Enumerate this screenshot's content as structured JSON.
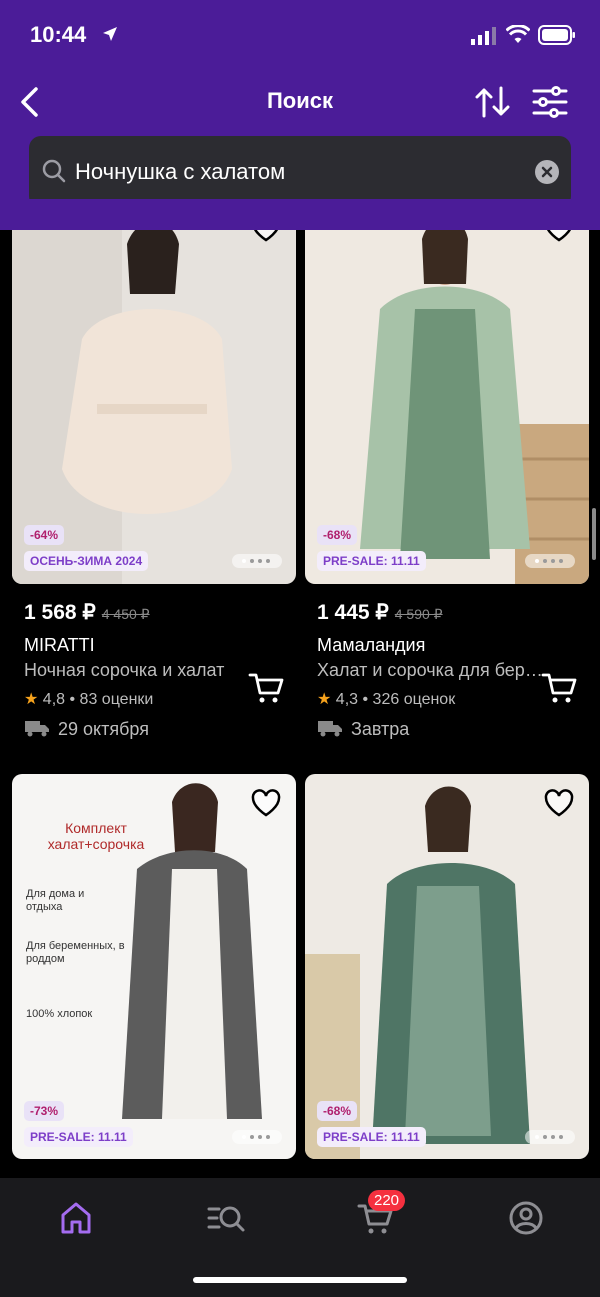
{
  "status": {
    "time": "10:44"
  },
  "header": {
    "title": "Поиск"
  },
  "search": {
    "value": "Ночнушка с халатом"
  },
  "products": [
    {
      "discount": "-64%",
      "tag": "ОСЕНЬ-ЗИМА 2024",
      "price": "1 568 ₽",
      "old_price": "4 450 ₽",
      "brand": "MIRATTI",
      "description": "Ночная сорочка и халат",
      "rating": "4,8",
      "reviews": "83 оценки",
      "delivery": "29 октября"
    },
    {
      "discount": "-68%",
      "tag": "PRE-SALE: 11.11",
      "price": "1 445 ₽",
      "old_price": "4 590 ₽",
      "brand": "Мамаландия",
      "description": "Халат и сорочка для беременных",
      "rating": "4,3",
      "reviews": "326 оценок",
      "delivery": "Завтра"
    },
    {
      "discount": "-73%",
      "tag": "PRE-SALE: 11.11",
      "image_texts": [
        "Комплект халат+сорочка",
        "Для дома и отдыха",
        "Для беременных, в роддом",
        "100% хлопок"
      ]
    },
    {
      "discount": "-68%",
      "tag": "PRE-SALE: 11.11"
    }
  ],
  "cart_badge": "220",
  "colors": {
    "header": "#4b1c98",
    "accent": "#a46cf0",
    "badge": "#f5303f",
    "star": "#f6a21c"
  }
}
